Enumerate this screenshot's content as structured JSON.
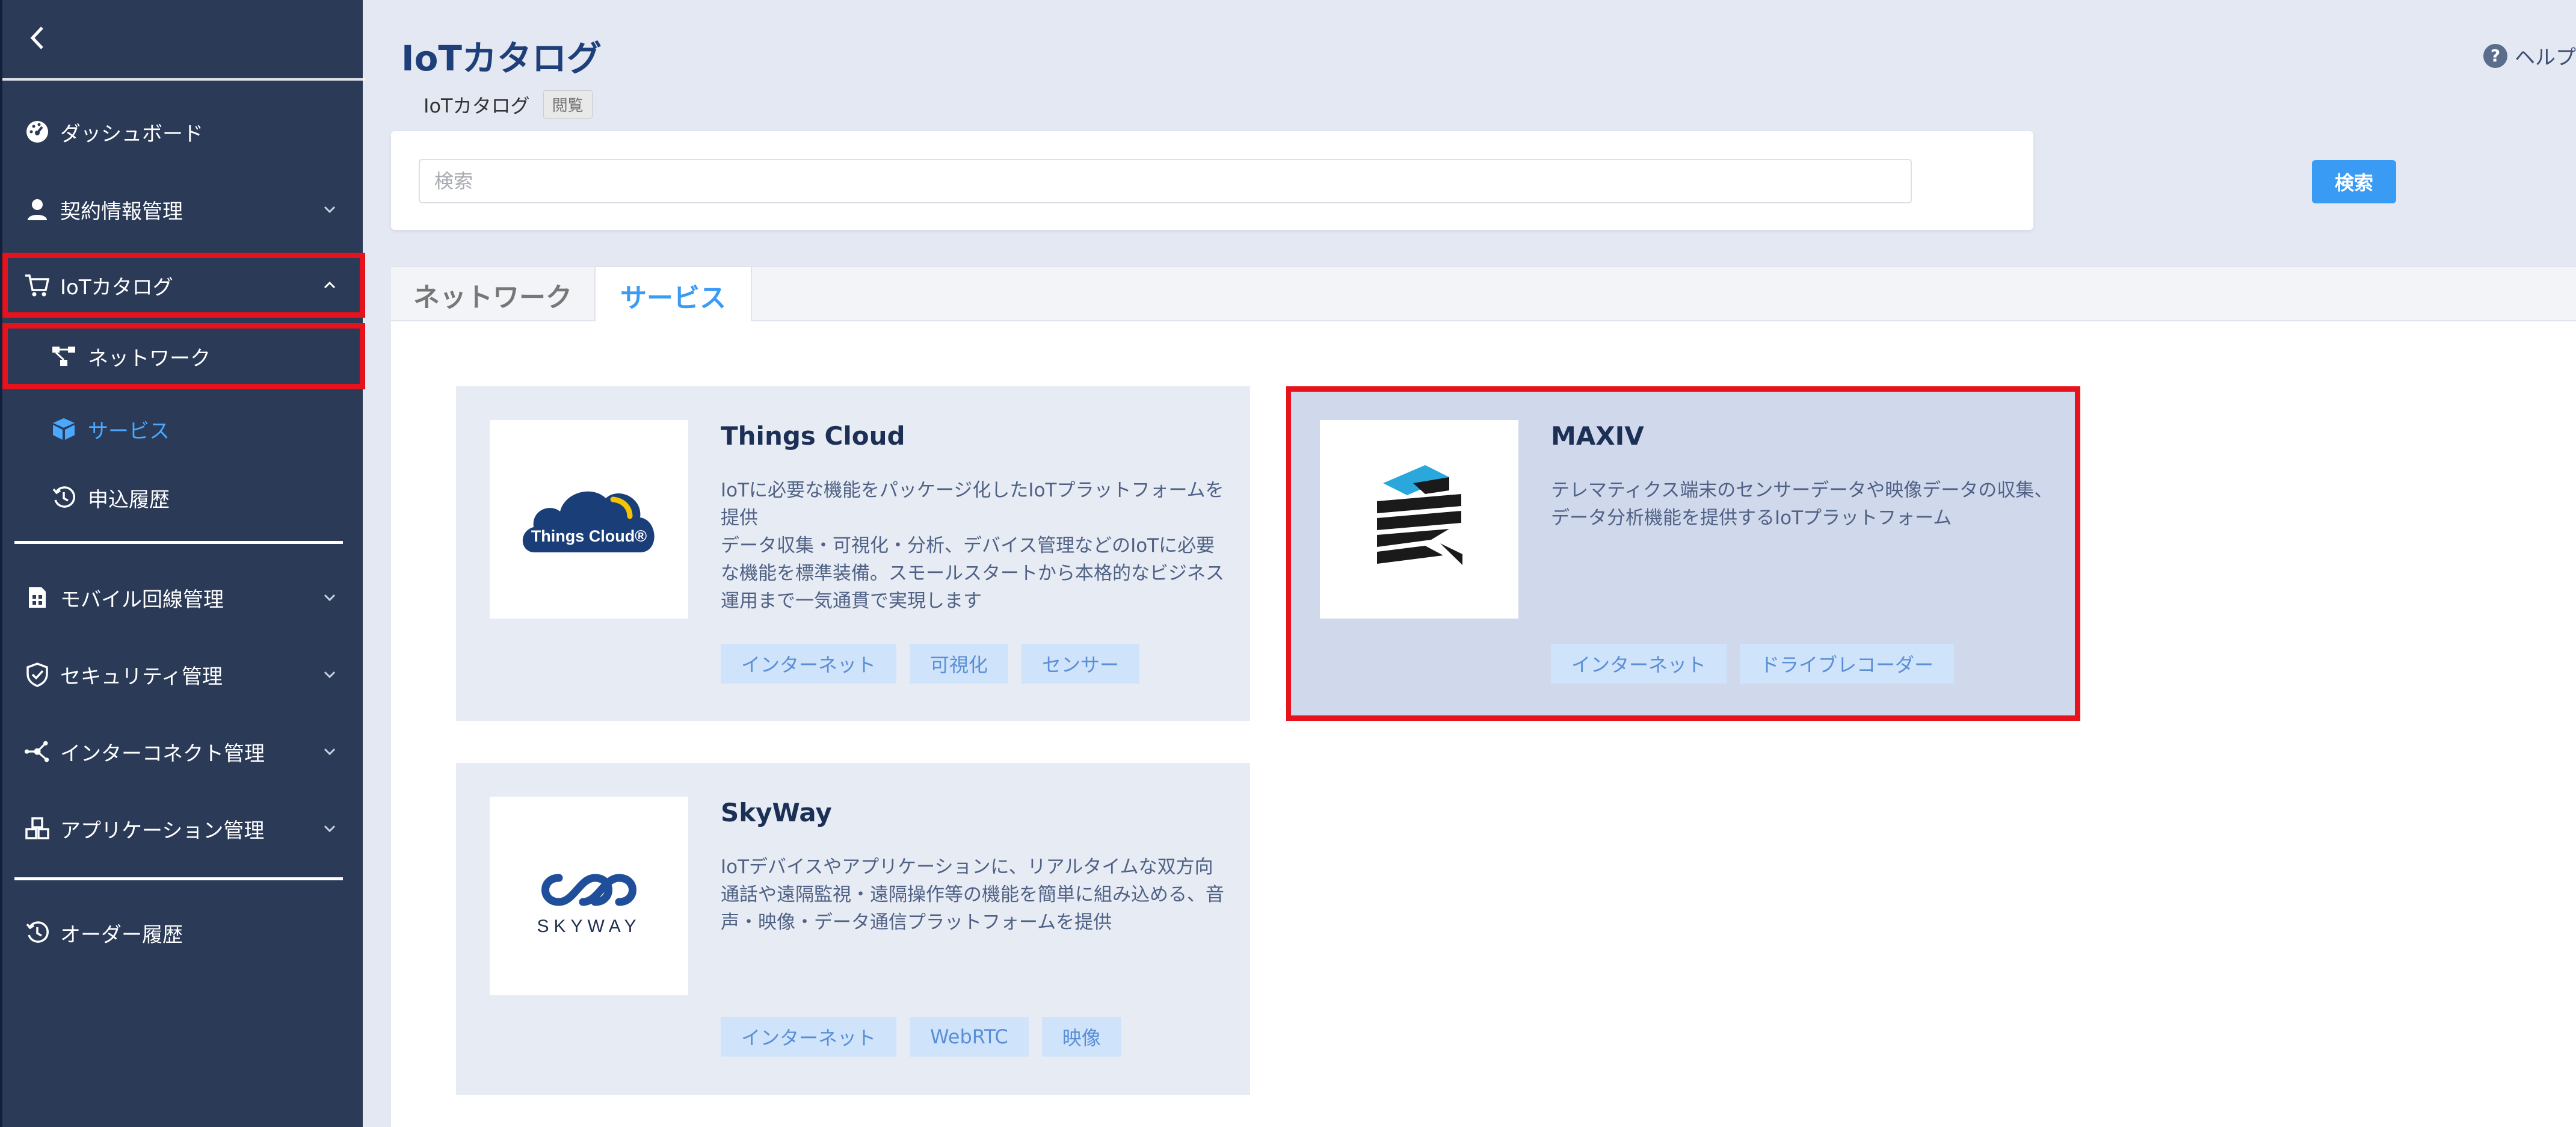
{
  "sidebar": {
    "items": [
      {
        "label": "ダッシュボード"
      },
      {
        "label": "契約情報管理"
      },
      {
        "label": "IoTカタログ"
      },
      {
        "label": "ネットワーク"
      },
      {
        "label": "サービス"
      },
      {
        "label": "申込履歴"
      },
      {
        "label": "モバイル回線管理"
      },
      {
        "label": "セキュリティ管理"
      },
      {
        "label": "インターコネクト管理"
      },
      {
        "label": "アプリケーション管理"
      },
      {
        "label": "オーダー履歴"
      }
    ]
  },
  "header": {
    "title": "IoTカタログ",
    "breadcrumb": "IoTカタログ",
    "view_badge": "閲覧",
    "help_label": "ヘルプ"
  },
  "search": {
    "placeholder": "検索",
    "button_label": "検索"
  },
  "tabs": [
    {
      "label": "ネットワーク"
    },
    {
      "label": "サービス"
    }
  ],
  "cards": [
    {
      "name": "Things Cloud",
      "logo_text": "Things Cloud®",
      "description": "IoTに必要な機能をパッケージ化したIoTプラットフォームを提供\nデータ収集・可視化・分析、デバイス管理などのIoTに必要な機能を標準装備。スモールスタートから本格的なビジネス運用まで一気通貫で実現します",
      "tags": [
        "インターネット",
        "可視化",
        "センサー"
      ]
    },
    {
      "name": "MAXIV",
      "description": "テレマティクス端末のセンサーデータや映像データの収集、データ分析機能を提供するIoTプラットフォーム",
      "tags": [
        "インターネット",
        "ドライブレコーダー"
      ]
    },
    {
      "name": "SkyWay",
      "logo_text": "SKYWAY",
      "description": "IoTデバイスやアプリケーションに、リアルタイムな双方向通話や遠隔監視・遠隔操作等の機能を簡単に組み込める、音声・映像・データ通信プラットフォームを提供",
      "tags": [
        "インターネット",
        "WebRTC",
        "映像"
      ]
    }
  ],
  "colors": {
    "sidebar_bg": "#2a3a57",
    "accent": "#3a9bf5",
    "highlight": "#e6121c",
    "title": "#1f3f7a"
  }
}
